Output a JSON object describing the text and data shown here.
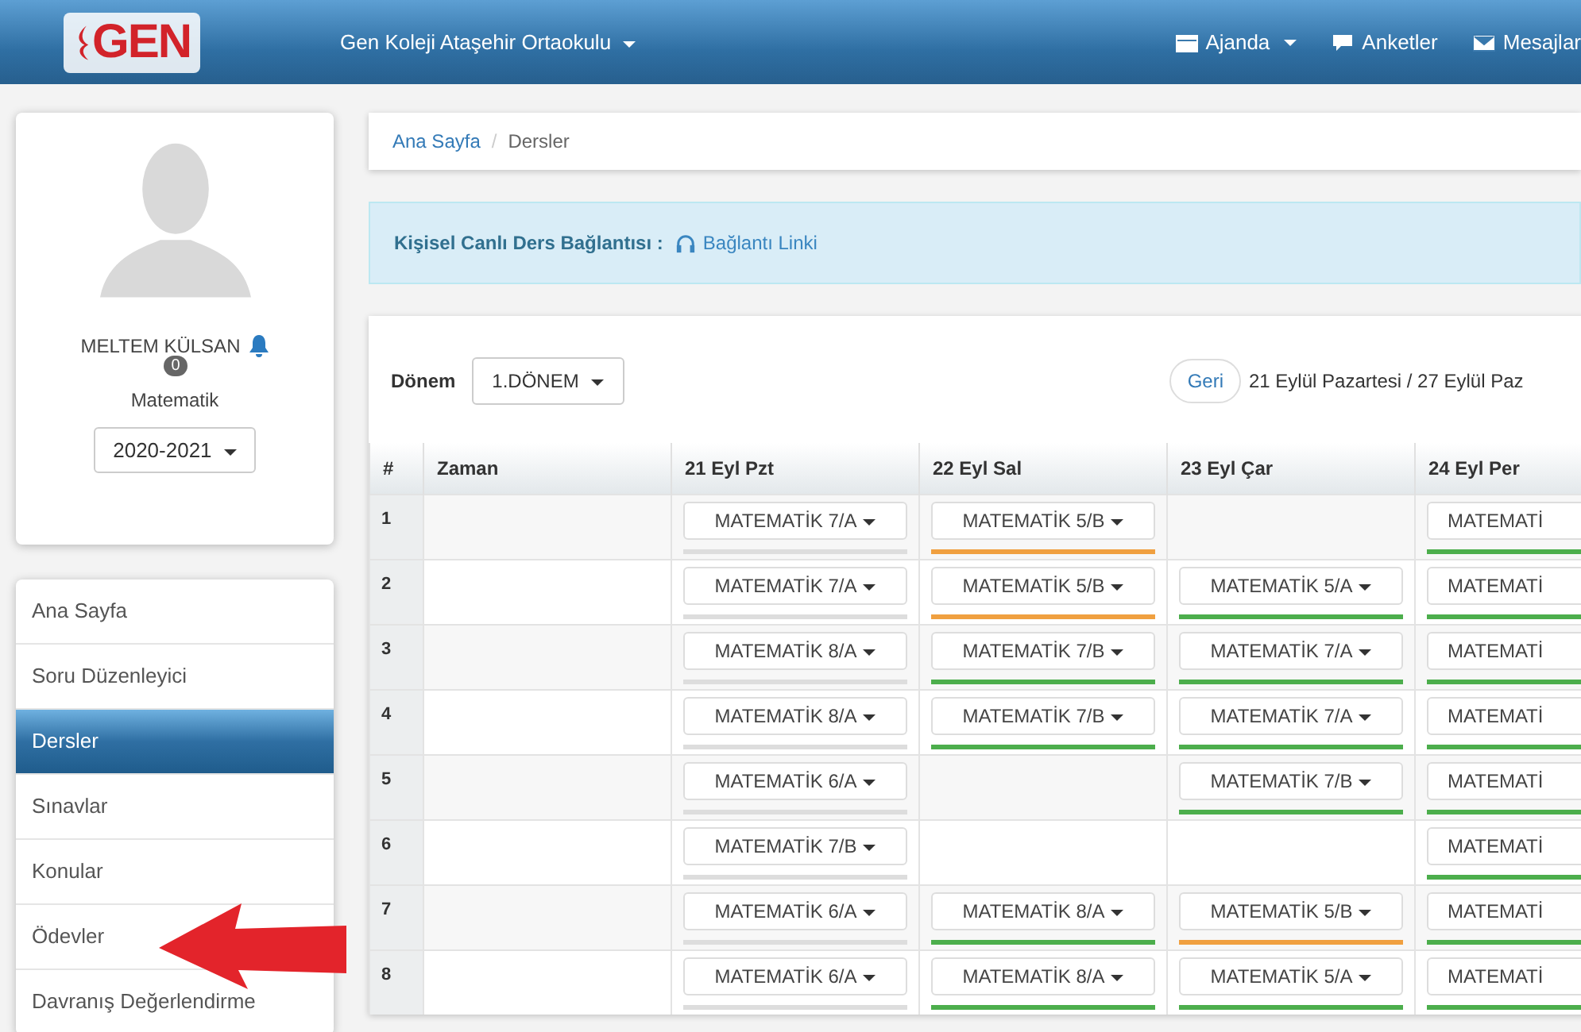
{
  "navbar": {
    "logo": "GEN",
    "school": "Gen Koleji Ataşehir Ortaokulu",
    "items": [
      {
        "kind": "calendar",
        "label": "Ajanda",
        "dropdown": true
      },
      {
        "kind": "chat",
        "label": "Anketler",
        "dropdown": false
      },
      {
        "kind": "mail",
        "label": "Mesajlar",
        "dropdown": false
      }
    ]
  },
  "profile": {
    "name": "MELTEM KÜLSAN",
    "badge": "0",
    "subject": "Matematik",
    "year": "2020-2021"
  },
  "menu": [
    {
      "label": "Ana Sayfa",
      "selected": false
    },
    {
      "label": "Soru Düzenleyici",
      "selected": false
    },
    {
      "label": "Dersler",
      "selected": true
    },
    {
      "label": "Sınavlar",
      "selected": false
    },
    {
      "label": "Konular",
      "selected": false
    },
    {
      "label": "Ödevler",
      "selected": false
    },
    {
      "label": "Davranış Değerlendirme",
      "selected": false
    }
  ],
  "breadcrumb": {
    "separator": "/",
    "items": [
      "Ana Sayfa",
      "Dersler"
    ]
  },
  "alert": {
    "label": "Kişisel Canlı Ders Bağlantısı :",
    "link": "Bağlantı Linki"
  },
  "toolbar": {
    "term_label": "Dönem",
    "term": "1.DÖNEM",
    "back": "Geri",
    "range": "21 Eylül Pazartesi / 27 Eylül Paz"
  },
  "table": {
    "columns": [
      "#",
      "Zaman",
      "21 Eyl Pzt",
      "22 Eyl Sal",
      "23 Eyl Çar",
      "24 Eyl Per"
    ],
    "rows": [
      {
        "cells": [
          "1",
          null,
          {
            "label": "MATEMATİK 7/A",
            "color": "#dddddd"
          },
          {
            "label": "MATEMATİK 5/B",
            "color": "#f0a040"
          },
          null,
          {
            "label": "MATEMATİ",
            "color": "#4cae4c"
          }
        ]
      },
      {
        "cells": [
          "2",
          null,
          {
            "label": "MATEMATİK 7/A",
            "color": "#dddddd"
          },
          {
            "label": "MATEMATİK 5/B",
            "color": "#f0a040"
          },
          {
            "label": "MATEMATİK 5/A",
            "color": "#4cae4c"
          },
          {
            "label": "MATEMATİ",
            "color": "#4cae4c"
          }
        ]
      },
      {
        "cells": [
          "3",
          null,
          {
            "label": "MATEMATİK 8/A",
            "color": "#dddddd"
          },
          {
            "label": "MATEMATİK 7/B",
            "color": "#4cae4c"
          },
          {
            "label": "MATEMATİK 7/A",
            "color": "#4cae4c"
          },
          {
            "label": "MATEMATİ",
            "color": "#4cae4c"
          }
        ]
      },
      {
        "cells": [
          "4",
          null,
          {
            "label": "MATEMATİK 8/A",
            "color": "#dddddd"
          },
          {
            "label": "MATEMATİK 7/B",
            "color": "#4cae4c"
          },
          {
            "label": "MATEMATİK 7/A",
            "color": "#4cae4c"
          },
          {
            "label": "MATEMATİ",
            "color": "#4cae4c"
          }
        ]
      },
      {
        "cells": [
          "5",
          null,
          {
            "label": "MATEMATİK 6/A",
            "color": "#dddddd"
          },
          null,
          {
            "label": "MATEMATİK 7/B",
            "color": "#4cae4c"
          },
          {
            "label": "MATEMATİ",
            "color": "#4cae4c"
          }
        ]
      },
      {
        "cells": [
          "6",
          null,
          {
            "label": "MATEMATİK 7/B",
            "color": "#dddddd"
          },
          null,
          null,
          {
            "label": "MATEMATİ",
            "color": "#4cae4c"
          }
        ]
      },
      {
        "cells": [
          "7",
          null,
          {
            "label": "MATEMATİK 6/A",
            "color": "#dddddd"
          },
          {
            "label": "MATEMATİK 8/A",
            "color": "#4cae4c"
          },
          {
            "label": "MATEMATİK 5/B",
            "color": "#f0a040"
          },
          {
            "label": "MATEMATİ",
            "color": "#4cae4c"
          }
        ]
      },
      {
        "cells": [
          "8",
          null,
          {
            "label": "MATEMATİK 6/A",
            "color": "#dddddd"
          },
          {
            "label": "MATEMATİK 8/A",
            "color": "#4cae4c"
          },
          {
            "label": "MATEMATİK 5/A",
            "color": "#4cae4c"
          },
          {
            "label": "MATEMATİ",
            "color": "#4cae4c"
          }
        ]
      }
    ]
  }
}
